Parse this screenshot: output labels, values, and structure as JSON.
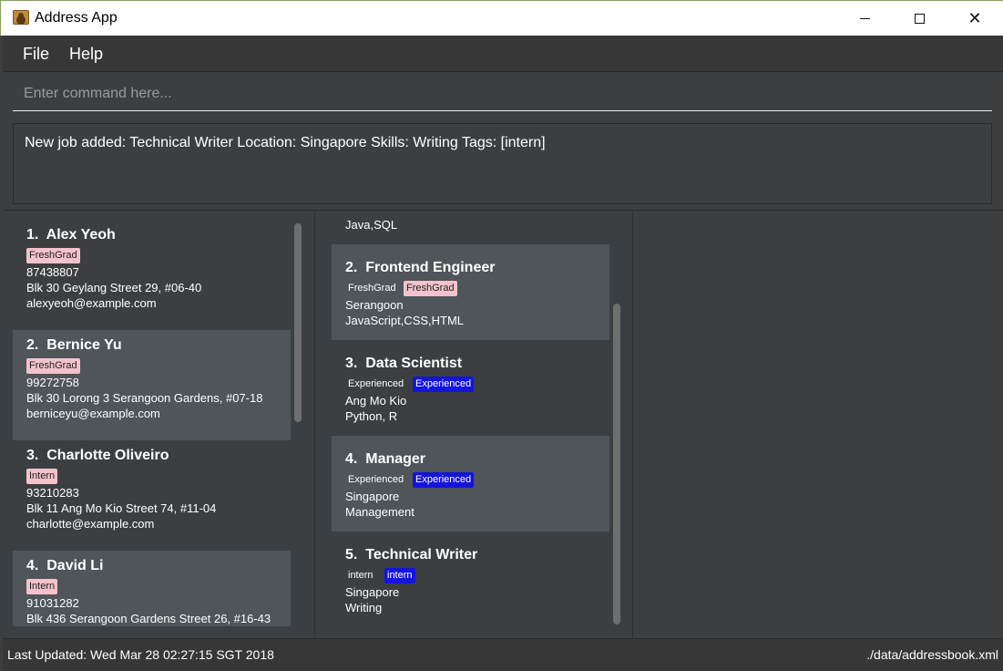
{
  "window": {
    "title": "Address App"
  },
  "menu": {
    "file": "File",
    "help": "Help"
  },
  "command": {
    "placeholder": "Enter command here..."
  },
  "result": {
    "text": "New job added: Technical Writer Location: Singapore Skills: Writing Tags: [intern]"
  },
  "persons": [
    {
      "index": "1.",
      "name": "Alex Yeoh",
      "tag": "FreshGrad",
      "phone": "87438807",
      "address": "Blk 30 Geylang Street 29, #06-40",
      "email": "alexyeoh@example.com"
    },
    {
      "index": "2.",
      "name": "Bernice Yu",
      "tag": "FreshGrad",
      "phone": "99272758",
      "address": "Blk 30 Lorong 3 Serangoon Gardens, #07-18",
      "email": "berniceyu@example.com"
    },
    {
      "index": "3.",
      "name": "Charlotte Oliveiro",
      "tag": "Intern",
      "phone": "93210283",
      "address": "Blk 11 Ang Mo Kio Street 74, #11-04",
      "email": "charlotte@example.com"
    },
    {
      "index": "4.",
      "name": "David Li",
      "tag": "Intern",
      "phone": "91031282",
      "address": "Blk 436 Serangoon Gardens Street 26, #16-43",
      "email": ""
    }
  ],
  "jobs": {
    "partial_top_skills": "Java,SQL",
    "items": [
      {
        "index": "2.",
        "title": "Frontend Engineer",
        "level": "FreshGrad",
        "tag": "FreshGrad",
        "tag_style": "pink",
        "location": "Serangoon",
        "skills": "JavaScript,CSS,HTML"
      },
      {
        "index": "3.",
        "title": "Data Scientist",
        "level": "Experienced",
        "tag": "Experienced",
        "tag_style": "blue",
        "location": "Ang Mo Kio",
        "skills": "Python, R"
      },
      {
        "index": "4.",
        "title": "Manager",
        "level": "Experienced",
        "tag": "Experienced",
        "tag_style": "blue",
        "location": "Singapore",
        "skills": "Management"
      },
      {
        "index": "5.",
        "title": "Technical Writer",
        "level": "intern",
        "tag": "intern",
        "tag_style": "blue",
        "location": "Singapore",
        "skills": "Writing"
      }
    ]
  },
  "status": {
    "last_updated": "Last Updated: Wed Mar 28 02:27:15 SGT 2018",
    "file_path": "./data/addressbook.xml"
  },
  "colors": {
    "background": "#3c3f41",
    "card_alt": "#4f5559",
    "tag_pink": "#f4c2cc",
    "tag_blue": "#1414dc"
  }
}
